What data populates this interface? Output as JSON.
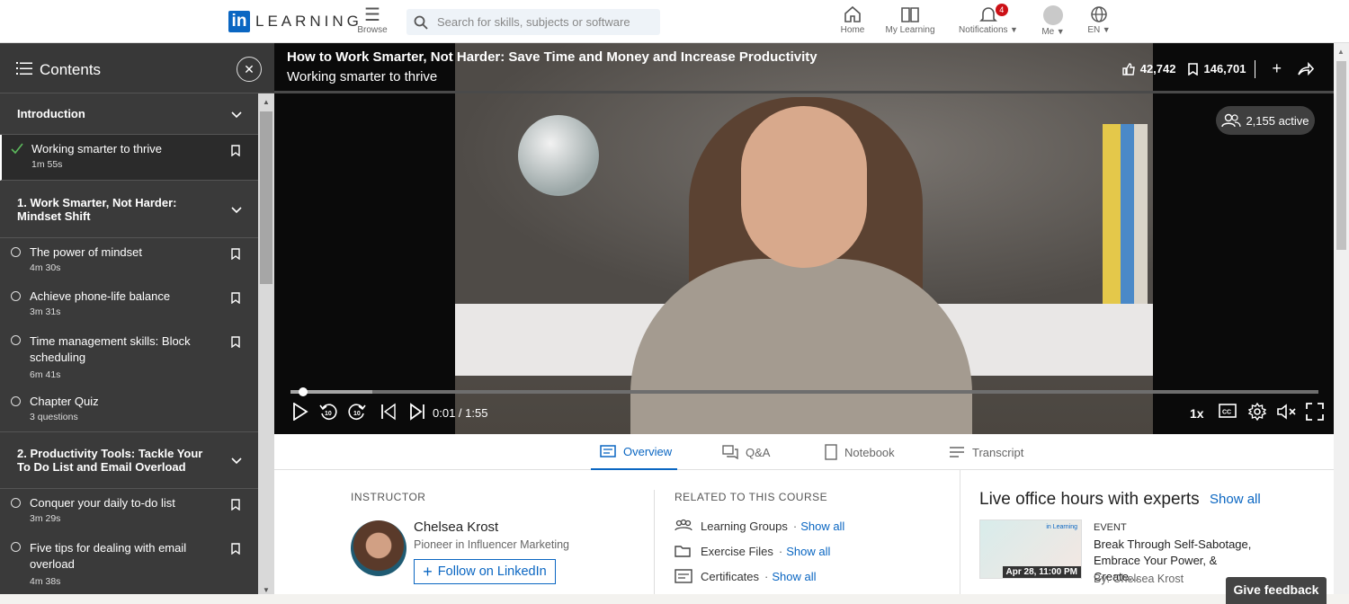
{
  "brand": {
    "logo_in": "in",
    "logo_word": "LEARNING"
  },
  "nav": {
    "browse": "Browse",
    "search_placeholder": "Search for skills, subjects or software",
    "home": "Home",
    "my_learning": "My Learning",
    "notifications": "Notifications",
    "notifications_count": "4",
    "me": "Me",
    "language": "EN"
  },
  "sidebar": {
    "title": "Contents",
    "sections": [
      {
        "title": "Introduction",
        "items": [
          {
            "title": "Working smarter to thrive",
            "duration": "1m 55s",
            "status": "completed"
          }
        ]
      },
      {
        "title": "1. Work Smarter, Not Harder: Mindset Shift",
        "items": [
          {
            "title": "The power of mindset",
            "duration": "4m 30s"
          },
          {
            "title": "Achieve phone-life balance",
            "duration": "3m 31s"
          },
          {
            "title": "Time management skills: Block scheduling",
            "duration": "6m 41s"
          },
          {
            "title": "Chapter Quiz",
            "duration": "3 questions"
          }
        ]
      },
      {
        "title": "2. Productivity Tools: Tackle Your To Do List and Email Overload",
        "items": [
          {
            "title": "Conquer your daily to-do list",
            "duration": "3m 29s"
          },
          {
            "title": "Five tips for dealing with email overload",
            "duration": "4m 38s"
          }
        ]
      }
    ]
  },
  "video": {
    "course_title": "How to Work Smarter, Not Harder: Save Time and Money and Increase Productivity",
    "video_title": "Working smarter to thrive",
    "likes": "42,742",
    "saves": "146,701",
    "active_learners": "2,155 active",
    "current_time": "0:01 / 1:55",
    "progress_fraction": 0.008,
    "buffered_fraction": 0.08,
    "speed": "1x"
  },
  "tabs": [
    "Overview",
    "Q&A",
    "Notebook",
    "Transcript"
  ],
  "instructor": {
    "label": "INSTRUCTOR",
    "name": "Chelsea Krost",
    "role": "Pioneer in Influencer Marketing",
    "follow": "Follow on LinkedIn"
  },
  "related": {
    "label": "RELATED TO THIS COURSE",
    "items": [
      {
        "label": "Learning Groups",
        "action": "Show all"
      },
      {
        "label": "Exercise Files",
        "action": "Show all"
      },
      {
        "label": "Certificates",
        "action": "Show all"
      }
    ]
  },
  "live": {
    "title": "Live office hours with experts",
    "show_all": "Show all",
    "event_kind": "EVENT",
    "event_title": "Break Through Self-Sabotage, Embrace Your Power, & Create...",
    "event_by": "By: Chelsea Krost",
    "event_date": "Apr 28, 11:00 PM"
  },
  "feedback": "Give feedback",
  "colors": {
    "accent": "#0a66c2",
    "sidebar_bg": "#3a3a3a",
    "video_bg": "#0a0a0a"
  }
}
